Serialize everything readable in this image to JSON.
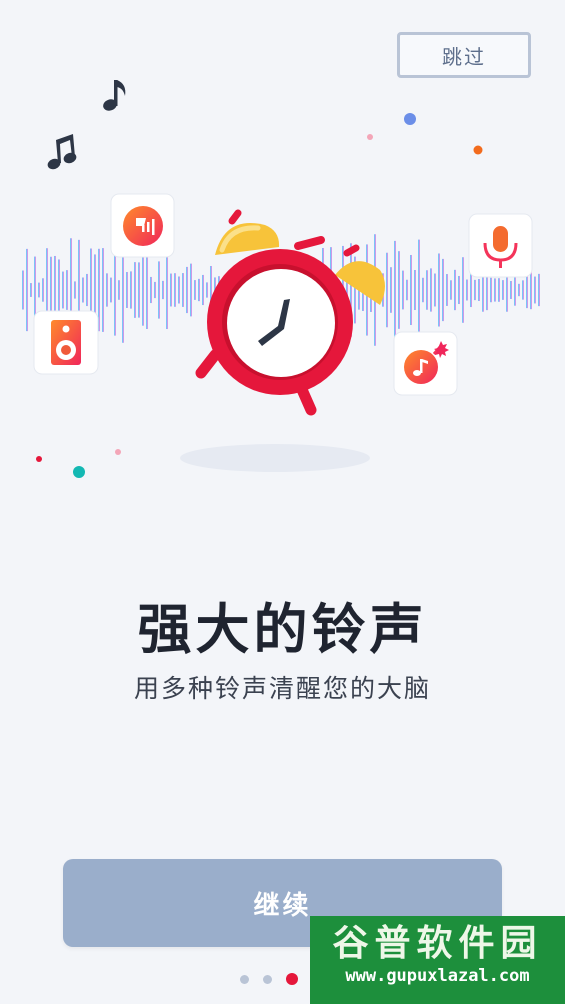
{
  "header": {
    "skip_label": "跳过"
  },
  "hero": {
    "icons": [
      "music-note-icon",
      "double-music-note-icon",
      "voice-chat-icon",
      "speaker-icon",
      "microphone-icon",
      "music-bomb-icon",
      "alarm-clock-icon"
    ],
    "colors": {
      "wave_cyan": "#46c9f0",
      "wave_blue": "#5d7ef0",
      "wave_pink": "#e77ee2",
      "clock_red": "#e5173b",
      "bell_yellow": "#f7c33a",
      "icon_orange": "#f36e2c"
    }
  },
  "content": {
    "title": "强大的铃声",
    "subtitle": "用多种铃声清醒您的大脑"
  },
  "footer": {
    "continue_label": "继续",
    "page_count": 4,
    "active_page": 3
  },
  "watermark": {
    "title": "谷普软件园",
    "url": "www.gupuxlazal.com"
  }
}
